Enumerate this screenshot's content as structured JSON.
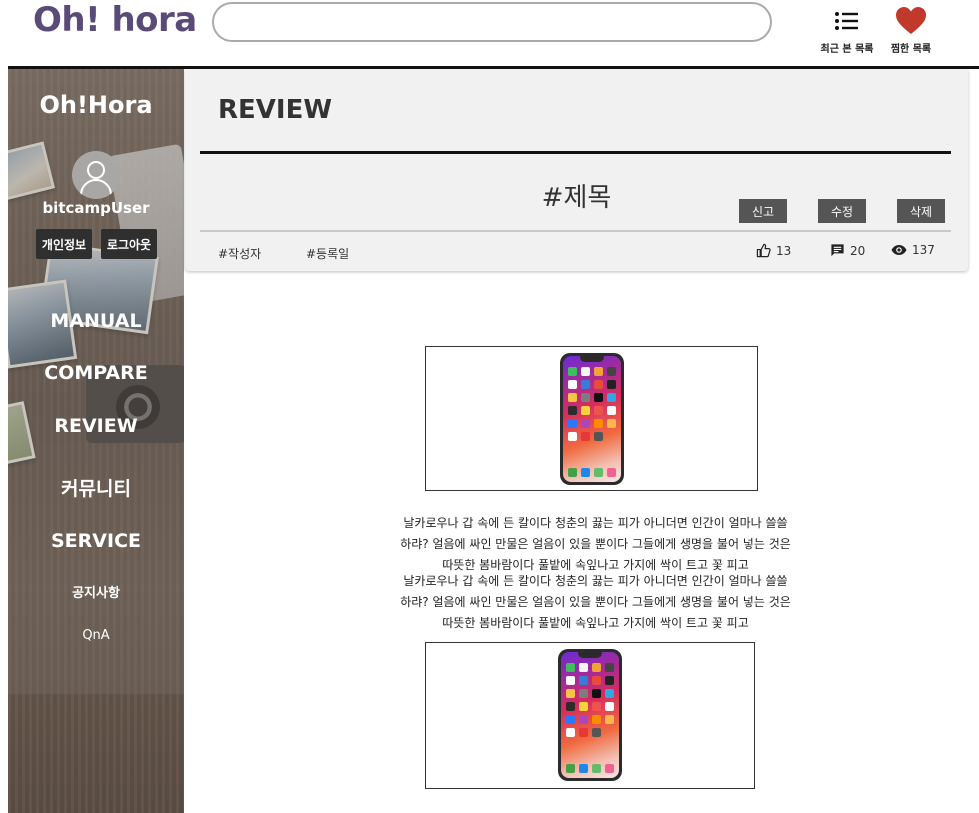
{
  "header": {
    "brand": "Oh! hora",
    "search": {
      "value": "",
      "placeholder": ""
    },
    "recent_label": "최근 본 목록",
    "wishlist_label": "찜한 목록",
    "accent_color": "#5a4a78",
    "heart_color": "#c0392b",
    "recent_icon": "list-icon",
    "wishlist_icon": "heart-icon"
  },
  "sidebar": {
    "brand": "Oh!Hora",
    "avatar_icon": "user-icon",
    "username": "bitcampUser",
    "info_button": "개인정보",
    "logout_button": "로그아웃",
    "nav": [
      "MANUAL",
      "COMPARE",
      "REVIEW",
      "커뮤니티",
      "SERVICE",
      "공지사항",
      "QnA"
    ]
  },
  "review": {
    "section_title": "REVIEW",
    "post_title": "#제목",
    "actions": {
      "report": "신고",
      "edit": "수정",
      "delete": "삭제"
    },
    "author": "#작성자",
    "date": "#등록일",
    "stats": {
      "likes": "13",
      "comments": "20",
      "views": "137"
    },
    "stat_icons": [
      "thumbs-up-icon",
      "comment-icon",
      "eye-icon"
    ]
  },
  "content": {
    "image_icon": "phone-image",
    "paragraph1": "날카로우나 갑 속에 든 칼이다 청춘의 끓는 피가 아니더면 인간이 얼마나 쓸쓸하랴? 얼음에 싸인 만물은 얼음이 있을 뿐이다 그들에게 생명을 불어 넣는 것은 따뜻한 봄바람이다 풀밭에 속잎나고 가지에 싹이 트고 꽃 피고",
    "paragraph2": "날카로우나 갑 속에 든 칼이다 청춘의 끓는 피가 아니더면 인간이 얼마나 쓸쓸하랴? 얼음에 싸인 만물은 얼음이 있을 뿐이다 그들에게 생명을 불어 넣는 것은 따뜻한 봄바람이다 풀밭에 속잎나고 가지에 싹이 트고 꽃 피고"
  }
}
